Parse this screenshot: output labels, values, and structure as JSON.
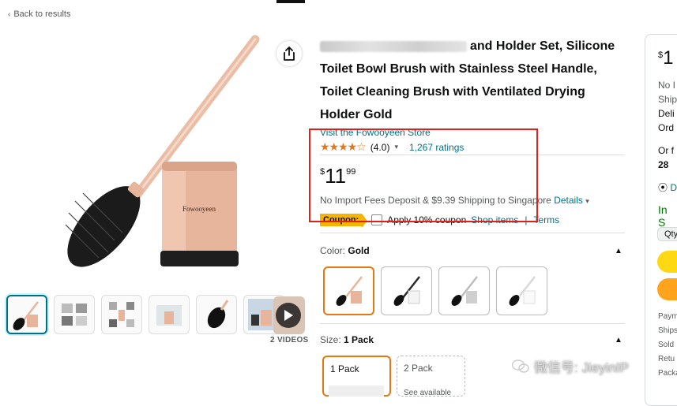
{
  "nav": {
    "back_label": "Back to results"
  },
  "gallery": {
    "videos_label": "2 VIDEOS",
    "main_logo_text": "Fowooyeen"
  },
  "product": {
    "title": "and Holder Set, Silicone Toilet Bowl Brush with Stainless Steel Handle, Toilet Cleaning Brush with Ventilated Drying Holder Gold",
    "store_link": "Visit the Fowooyeen Store",
    "rating_value": "(4.0)",
    "ratings_count": "1,267 ratings",
    "price_symbol": "$",
    "price_whole": "11",
    "price_fraction": "99",
    "shipping_text": "No Import Fees Deposit & $9.39 Shipping to Singapore",
    "details_label": "Details",
    "coupon_badge": "Coupon:",
    "coupon_text": "Apply 10% coupon",
    "shop_items_label": "Shop items",
    "terms_label": "Terms",
    "color_label": "Color:",
    "color_value": "Gold",
    "size_label": "Size:",
    "size_value": "1 Pack",
    "size_options": [
      "1 Pack",
      "2 Pack"
    ],
    "size_option_2_sub": "See available",
    "swatch_colors": [
      "#e8b9a0",
      "#2b2b2b",
      "#cfcfcf",
      "#f2f2f2"
    ]
  },
  "buybox": {
    "price_symbol": "$",
    "price_whole": "1",
    "line1": "No I",
    "line2": "Ship",
    "line3": "Deli",
    "line4": "Ord",
    "line5": "Or f",
    "line6": "28",
    "deliver_label": "D",
    "stock": "In S",
    "qty_label": "Qty",
    "foot1": "Paym",
    "foot2": "Ships",
    "foot3": "Sold",
    "foot4": "Retu",
    "foot5": "Packa"
  },
  "watermark": {
    "text": "微信号: JieyinIP"
  },
  "colors": {
    "accent_link": "#007185",
    "star": "#de7921",
    "highlight_box": "#e0201b",
    "selected_border": "#e47911"
  }
}
